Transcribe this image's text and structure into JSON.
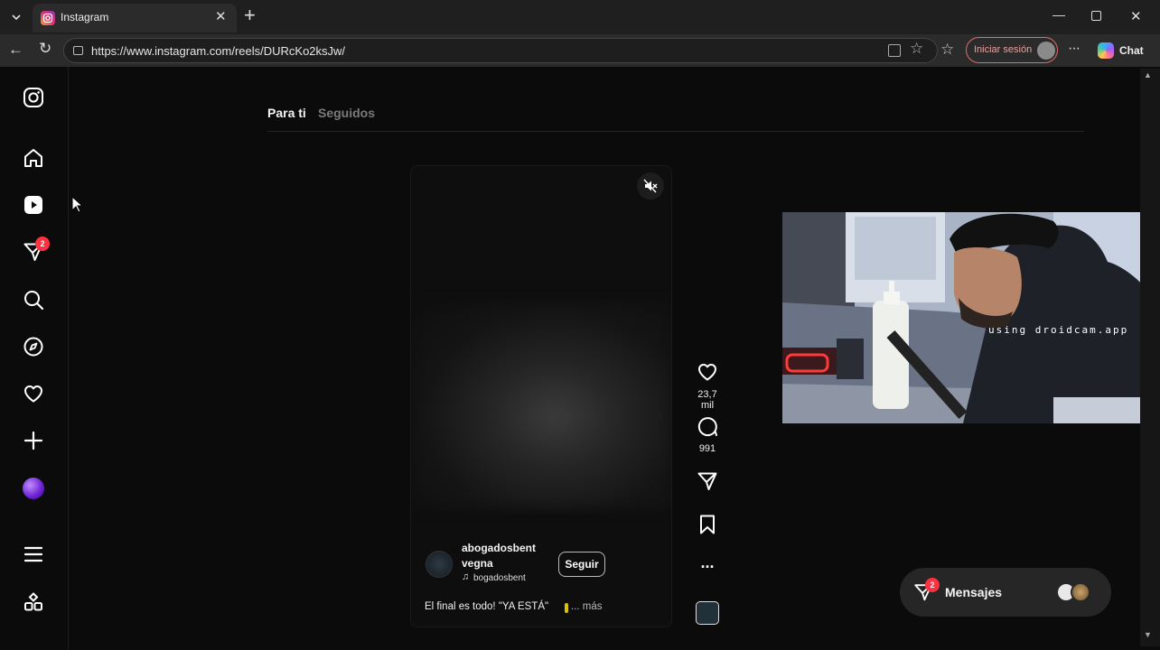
{
  "browser": {
    "tab_title": "Instagram",
    "url": "https://www.instagram.com/reels/DURcKo2ksJw/",
    "signin_label": "Iniciar sesión",
    "chat_label": "Chat"
  },
  "sidebar": {
    "notification_count": "2"
  },
  "feed": {
    "tabs": [
      "Para ti",
      "Seguidos"
    ]
  },
  "reel": {
    "username_line1": "abogadosbent",
    "username_line2": "vegna",
    "audio_label": "bogadosbent",
    "follow_label": "Seguir",
    "caption": "El final es todo! \"YA ESTÁ\"",
    "more_label": "... más",
    "likes": "23,7 mil",
    "comments": "991"
  },
  "overlay": {
    "watermark": "using droidcam.app"
  },
  "messages": {
    "label": "Mensajes",
    "count": "2"
  },
  "colors": {
    "background": "#0b0b0b",
    "badge": "#ff3040",
    "signin_border": "#e06c6c"
  }
}
